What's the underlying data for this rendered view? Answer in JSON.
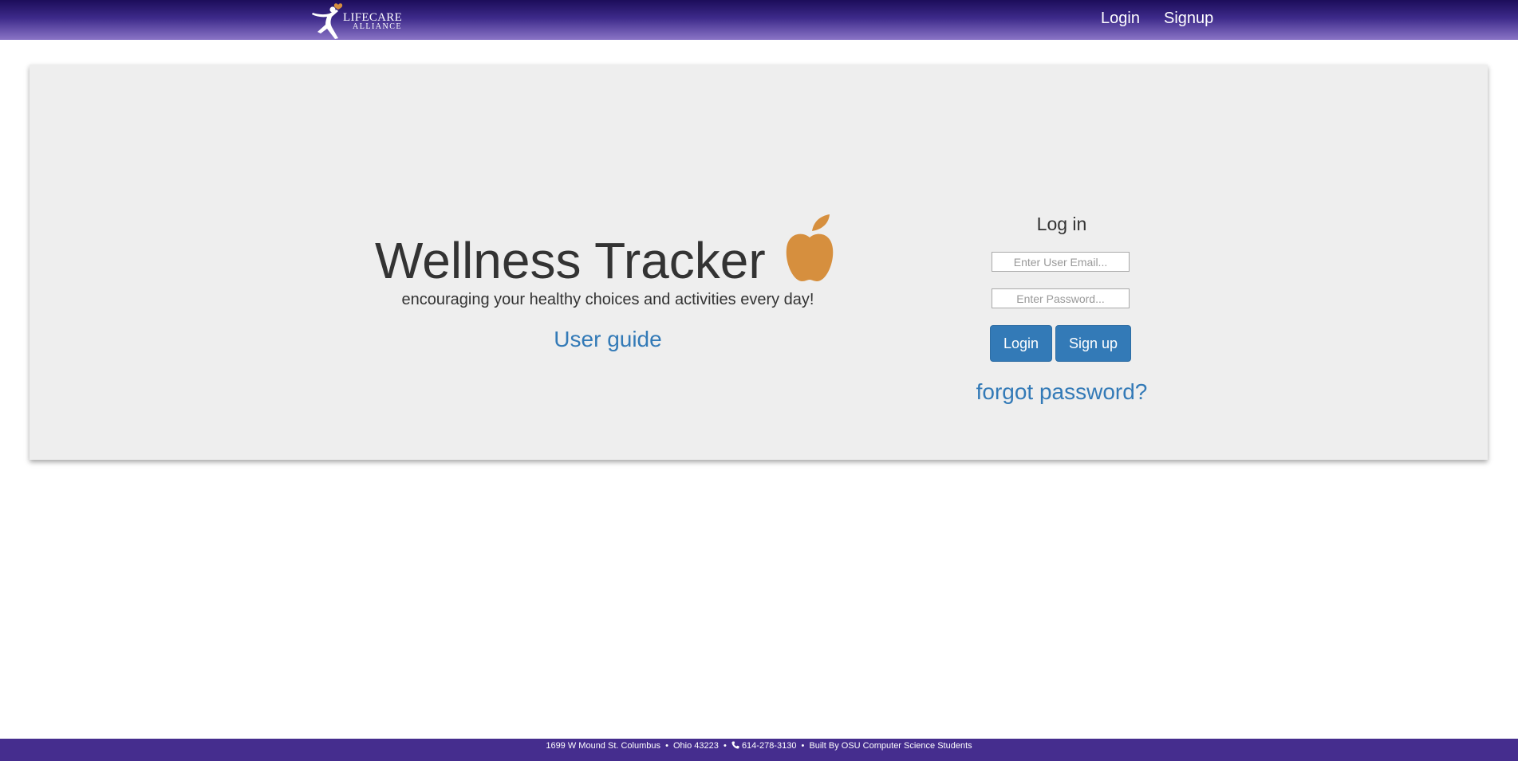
{
  "navbar": {
    "brand": {
      "line1": "LIFECARE",
      "line2": "ALLIANCE",
      "icon": "person-heart-logo-icon"
    },
    "links": [
      {
        "label": "Login"
      },
      {
        "label": "Signup"
      }
    ]
  },
  "hero": {
    "title": "Wellness Tracker",
    "title_icon": "apple-icon",
    "subtitle": "encouraging your healthy choices and activities every day!",
    "user_guide_link": "User guide"
  },
  "login": {
    "heading": "Log in",
    "email_placeholder": "Enter User Email...",
    "password_placeholder": "Enter Password...",
    "login_button": "Login",
    "signup_button": "Sign up",
    "forgot_link": "forgot password?"
  },
  "footer": {
    "address": "1699 W Mound St. Columbus",
    "state": "Ohio 43223",
    "phone_icon": "phone-icon",
    "phone": "614-278-3130",
    "credit": "Built By OSU Computer Science Students",
    "separator": "•"
  },
  "colors": {
    "navbar_top": "#1c0d5a",
    "navbar_bottom": "#8a74c6",
    "jumbotron_bg": "#eeeeee",
    "link": "#337ab7",
    "button": "#337ab7",
    "apple": "#d68f3e",
    "footer_bg": "#452d8e"
  }
}
